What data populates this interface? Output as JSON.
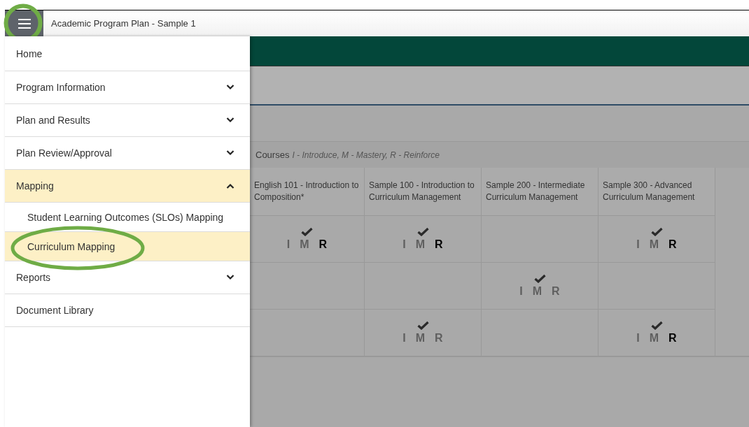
{
  "header": {
    "title": "Academic Program Plan - Sample 1"
  },
  "menu": [
    {
      "label": "Home"
    },
    {
      "label": "Program Information",
      "expanded": false
    },
    {
      "label": "Plan and Results",
      "expanded": false
    },
    {
      "label": "Plan Review/Approval",
      "expanded": false
    },
    {
      "label": "Mapping",
      "expanded": true,
      "children": [
        {
          "label": "Student Learning Outcomes (SLOs) Mapping",
          "selected": false
        },
        {
          "label": "Curriculum Mapping",
          "selected": true
        }
      ]
    },
    {
      "label": "Reports",
      "expanded": false
    },
    {
      "label": "Document Library"
    }
  ],
  "courses": {
    "title": "Courses",
    "legend": "I - Introduce, M - Mastery, R - Reinforce",
    "columns": [
      "English 101 - Introduction to Composition*",
      "Sample 100 - Introduction to Curriculum Management",
      "Sample 200 - Intermediate Curriculum Management",
      "Sample 300 - Advanced Curriculum Management"
    ],
    "rows": [
      [
        {
          "checked": true,
          "levels": [
            {
              "letter": "I",
              "on": false
            },
            {
              "letter": "M",
              "on": false
            },
            {
              "letter": "R",
              "on": true
            }
          ]
        },
        {
          "checked": true,
          "levels": [
            {
              "letter": "I",
              "on": false
            },
            {
              "letter": "M",
              "on": false
            },
            {
              "letter": "R",
              "on": true
            }
          ]
        },
        {
          "checked": false
        },
        {
          "checked": true,
          "levels": [
            {
              "letter": "I",
              "on": false
            },
            {
              "letter": "M",
              "on": false
            },
            {
              "letter": "R",
              "on": true
            }
          ]
        }
      ],
      [
        {
          "checked": false
        },
        {
          "checked": false
        },
        {
          "checked": true,
          "levels": [
            {
              "letter": "I",
              "on": false
            },
            {
              "letter": "M",
              "on": false
            },
            {
              "letter": "R",
              "on": false
            }
          ]
        },
        {
          "checked": false
        }
      ],
      [
        {
          "checked": false
        },
        {
          "checked": true,
          "levels": [
            {
              "letter": "I",
              "on": false
            },
            {
              "letter": "M",
              "on": false
            },
            {
              "letter": "R",
              "on": false
            }
          ]
        },
        {
          "checked": false
        },
        {
          "checked": true,
          "levels": [
            {
              "letter": "I",
              "on": false
            },
            {
              "letter": "M",
              "on": false
            },
            {
              "letter": "R",
              "on": true
            }
          ]
        }
      ]
    ]
  }
}
